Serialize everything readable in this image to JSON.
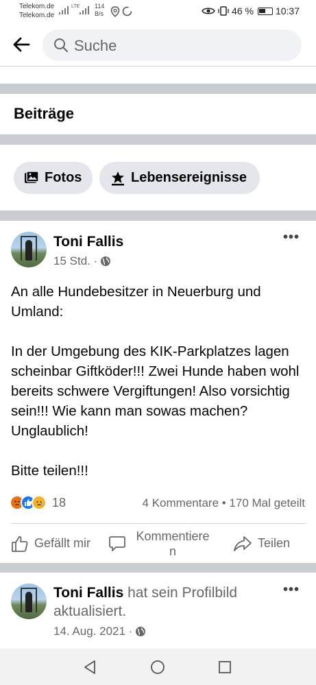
{
  "status_bar": {
    "carrier_1": "Telekom.de",
    "carrier_2": "Telekom.de",
    "network": "LTE",
    "speed_value": "114",
    "speed_unit": "B/s",
    "battery": "46 %",
    "time": "10:37"
  },
  "header": {
    "search_placeholder": "Suche"
  },
  "section": {
    "title": "Beiträge"
  },
  "filters": [
    {
      "label": "Fotos",
      "icon": "photos-icon"
    },
    {
      "label": "Lebensereignisse",
      "icon": "star-flag-icon"
    }
  ],
  "post": {
    "author": "Toni Fallis",
    "time": "15 Std. ·",
    "audience_icon": "globe-icon",
    "text": [
      "An alle Hundebesitzer in Neuerburg und Umland:",
      "In der Umgebung des KIK-Parkplatzes lagen scheinbar Giftköder!!! Zwei Hunde haben wohl bereits schwere Vergiftungen! Also vorsichtig sein!!! Wie kann man sowas machen? Unglaublich!",
      "Bitte teilen!!!"
    ],
    "reaction_count": "18",
    "comments_shares": "4 Kommentare • 170 Mal geteilt",
    "actions": {
      "like": "Gefällt mir",
      "comment_line1": "Kommentiere",
      "comment_line2": "n",
      "share": "Teilen"
    }
  },
  "post2": {
    "author": "Toni Fallis",
    "action_text": " hat sein Profilbild aktualisiert.",
    "time": "14. Aug. 2021 ·",
    "audience_icon": "globe-icon"
  },
  "colors": {
    "brand_blue": "#1877f2",
    "divider": "#c9ccd1",
    "chip_bg": "#e4e6eb",
    "secondary_text": "#65676b"
  }
}
